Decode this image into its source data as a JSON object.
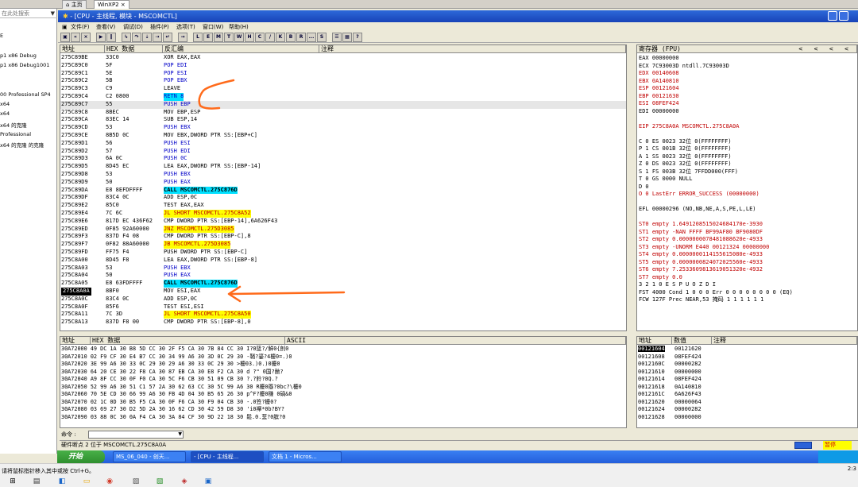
{
  "host": {
    "tabs": [
      "主页",
      "WinXP2"
    ],
    "sidebar_search": "在此处搜索",
    "sidebar_items": [
      "E",
      "p1 x86 Debug",
      "p1 x86 Debug1001",
      "00 Professional SP4",
      "x64",
      "x64 的克隆",
      "Professional",
      "x64 的克隆 的克隆"
    ],
    "status_hint": "请将鼠标指针移入其中或按 Ctrl+G。",
    "clock": "2:3"
  },
  "window": {
    "title": "- [CPU - 主线程, 模块 - MSCOMCTL]",
    "menus": [
      "文件(F)",
      "查看(V)",
      "调试(D)",
      "插件(P)",
      "选项(T)",
      "窗口(W)",
      "帮助(H)"
    ],
    "toolbar_letters": [
      "L",
      "E",
      "M",
      "T",
      "W",
      "H",
      "C",
      "/",
      "K",
      "B",
      "R",
      "...",
      "S"
    ]
  },
  "disasm": {
    "headers": [
      "地址",
      "HEX 数据",
      "反汇编",
      "注释"
    ],
    "rows": [
      {
        "addr": "275C89BE",
        "hex": "33C0",
        "asm": "XOR EAX,EAX",
        "style": ""
      },
      {
        "addr": "275C89C0",
        "hex": "5F",
        "asm": "POP EDI",
        "style": "blu"
      },
      {
        "addr": "275C89C1",
        "hex": "5E",
        "asm": "POP ESI",
        "style": "blu"
      },
      {
        "addr": "275C89C2",
        "hex": "5B",
        "asm": "POP EBX",
        "style": "blu"
      },
      {
        "addr": "275C89C3",
        "hex": "C9",
        "asm": "LEAVE",
        "style": ""
      },
      {
        "addr": "275C89C4",
        "hex": "C2 0800",
        "asm": "RETN 8",
        "style": "retn"
      },
      {
        "addr": "275C89C7",
        "hex": "55",
        "asm": "PUSH EBP",
        "style": "blu hl"
      },
      {
        "addr": "275C89C8",
        "hex": "8BEC",
        "asm": "MOV EBP,ESP",
        "style": ""
      },
      {
        "addr": "275C89CA",
        "hex": "83EC 14",
        "asm": "SUB ESP,14",
        "style": ""
      },
      {
        "addr": "275C89CD",
        "hex": "53",
        "asm": "PUSH EBX",
        "style": "blu"
      },
      {
        "addr": "275C89CE",
        "hex": "8B5D 0C",
        "asm": "MOV EBX,DWORD PTR SS:[EBP+C]",
        "style": "mem"
      },
      {
        "addr": "275C89D1",
        "hex": "56",
        "asm": "PUSH ESI",
        "style": "blu"
      },
      {
        "addr": "275C89D2",
        "hex": "57",
        "asm": "PUSH EDI",
        "style": "blu"
      },
      {
        "addr": "275C89D3",
        "hex": "6A 0C",
        "asm": "PUSH 0C",
        "style": "blu"
      },
      {
        "addr": "275C89D5",
        "hex": "8D45 EC",
        "asm": "LEA EAX,DWORD PTR SS:[EBP-14]",
        "style": "mem"
      },
      {
        "addr": "275C89D8",
        "hex": "53",
        "asm": "PUSH EBX",
        "style": "blu"
      },
      {
        "addr": "275C89D9",
        "hex": "50",
        "asm": "PUSH EAX",
        "style": "blu"
      },
      {
        "addr": "275C89DA",
        "hex": "E8 8EFDFFFF",
        "asm": "CALL MSCOMCTL.275C876D",
        "style": "call"
      },
      {
        "addr": "275C89DF",
        "hex": "83C4 0C",
        "asm": "ADD ESP,0C",
        "style": ""
      },
      {
        "addr": "275C89E2",
        "hex": "85C0",
        "asm": "TEST EAX,EAX",
        "style": ""
      },
      {
        "addr": "275C89E4",
        "hex": "7C 6C",
        "asm": "JL SHORT MSCOMCTL.275C8A52",
        "style": "jmp"
      },
      {
        "addr": "275C89E6",
        "hex": "817D EC 436F62",
        "asm": "CMP DWORD PTR SS:[EBP-14],6A626F43",
        "style": "mem"
      },
      {
        "addr": "275C89ED",
        "hex": "0F85 92A60000",
        "asm": "JNZ MSCOMCTL.275D3085",
        "style": "jmp"
      },
      {
        "addr": "275C89F3",
        "hex": "837D F4 08",
        "asm": "CMP DWORD PTR SS:[EBP-C],8",
        "style": "mem"
      },
      {
        "addr": "275C89F7",
        "hex": "0F82 88A60000",
        "asm": "JB MSCOMCTL.275D3085",
        "style": "jmp"
      },
      {
        "addr": "275C89FD",
        "hex": "FF75 F4",
        "asm": "PUSH DWORD PTR SS:[EBP-C]",
        "style": "mem"
      },
      {
        "addr": "275C8A00",
        "hex": "8D45 F8",
        "asm": "LEA EAX,DWORD PTR SS:[EBP-8]",
        "style": "mem"
      },
      {
        "addr": "275C8A03",
        "hex": "53",
        "asm": "PUSH EBX",
        "style": "blu"
      },
      {
        "addr": "275C8A04",
        "hex": "50",
        "asm": "PUSH EAX",
        "style": "blu"
      },
      {
        "addr": "275C8A05",
        "hex": "E8 63FDFFFF",
        "asm": "CALL MSCOMCTL.275C876D",
        "style": "call"
      },
      {
        "addr": "275C8A0A",
        "hex": "8BF0",
        "asm": "MOV ESI,EAX",
        "style": "sel"
      },
      {
        "addr": "275C8A0C",
        "hex": "83C4 0C",
        "asm": "ADD ESP,0C",
        "style": ""
      },
      {
        "addr": "275C8A0F",
        "hex": "85F6",
        "asm": "TEST ESI,ESI",
        "style": ""
      },
      {
        "addr": "275C8A11",
        "hex": "7C 3D",
        "asm": "JL SHORT MSCOMCTL.275C8A50",
        "style": "jmp"
      },
      {
        "addr": "275C8A13",
        "hex": "837D F8 00",
        "asm": "CMP DWORD PTR SS:[EBP-8],0",
        "style": "mem"
      }
    ]
  },
  "registers": {
    "title": "寄存器 (FPU)",
    "lines": [
      {
        "t": "EAX 00000000",
        "c": ""
      },
      {
        "t": "ECX 7C93003D ntdll.7C93003D",
        "c": ""
      },
      {
        "t": "EDX 00140608",
        "c": "red"
      },
      {
        "t": "EBX 0A140810",
        "c": "red"
      },
      {
        "t": "ESP 00121604",
        "c": "red"
      },
      {
        "t": "EBP 00121630",
        "c": "red"
      },
      {
        "t": "ESI 08FEF424",
        "c": "red"
      },
      {
        "t": "EDI 00000000",
        "c": ""
      },
      {
        "t": "",
        "c": ""
      },
      {
        "t": "EIP 275C8A0A MSCOMCTL.275C8A0A",
        "c": ""
      },
      {
        "t": "",
        "c": ""
      },
      {
        "t": "C 0  ES 0023 32位 0(FFFFFFFF)",
        "c": ""
      },
      {
        "t": "P 1  CS 001B 32位 0(FFFFFFFF)",
        "c": ""
      },
      {
        "t": "A 1  SS 0023 32位 0(FFFFFFFF)",
        "c": ""
      },
      {
        "t": "Z 0  DS 0023 32位 0(FFFFFFFF)",
        "c": ""
      },
      {
        "t": "S 1  FS 003B 32位 7FFDD000(FFF)",
        "c": ""
      },
      {
        "t": "T 0  GS 0000 NULL",
        "c": ""
      },
      {
        "t": "D 0",
        "c": ""
      },
      {
        "t": "O 0  LastErr ERROR_SUCCESS (00000000)",
        "c": ""
      },
      {
        "t": "",
        "c": ""
      },
      {
        "t": "EFL 00000296 (NO,NB,NE,A,S,PE,L,LE)",
        "c": ""
      },
      {
        "t": "",
        "c": ""
      },
      {
        "t": "ST0 empty 1.6491208515024684170e-3930",
        "c": ""
      },
      {
        "t": "ST1 empty -NAN FFFF BF99AF80 BF9080DF",
        "c": ""
      },
      {
        "t": "ST2 empty 0.0000000078481088620e-4933",
        "c": ""
      },
      {
        "t": "ST3 empty -UNORM E440 00121324 00000000",
        "c": ""
      },
      {
        "t": "ST4 empty 0.0000000114155615080e-4933",
        "c": ""
      },
      {
        "t": "ST5 empty 0.0000000824072025560e-4933",
        "c": ""
      },
      {
        "t": "ST6 empty 7.2533609813619051320e-4932",
        "c": ""
      },
      {
        "t": "ST7 empty 0.0",
        "c": ""
      },
      {
        "t": "               3 2 1 0      E S P U O Z D I",
        "c": ""
      },
      {
        "t": "FST 4000  Cond 1 0 0 0  Err 0 0 0 0 0 0 0 0  (EQ)",
        "c": ""
      },
      {
        "t": "FCW 127F  Prec NEAR,53  掩码    1 1 1 1 1 1",
        "c": ""
      }
    ]
  },
  "dump": {
    "headers": [
      "地址",
      "HEX 数据",
      "ASCII"
    ],
    "rows": [
      "30A72000 49 DC 1A 30 B8 5D CC 30 2F F5 CA 30 7B 84 CC 30  I?0篮?/鮮0{剆0",
      "30A72010 02 F9 CF 30 E4 B7 CC 30 34 99 A6 30 3D 0C 29 30  -鞘?鎏?4櫦0=.)0",
      "30A72020 3E 99 A6 30 33 0C 29 30 29 A6 30 33 0C 29 30  >櫦03.)0.)0櫦0",
      "30A72030 64 20 CE 30 22 F8 CA 30 87 EB CA 30 E8 F2 CA 30  d ?\" 0国?酏?",
      "30A72040 A9 8F CC 30 0F F0 CA 30 5C F6 CB 30 51 09 CB 30  ?.?鈴?0Q.?",
      "30A72050 52 99 A6 30 51 C1 57 2A 30 62 63 CC 30 5C 99 A6 30  R櫦0羉?0bc?\\櫦0",
      "30A72060 70 5E CD 30 66 99 A6 30 FB 4D 04 30 B5 65 26 30  p^F?櫦0稴 0碢&0",
      "30A72070 02 1C 0D 30 B5 F5 CA 30 0F F6 CA 30 F9 04 CB 30  -.0笠?櫦0?",
      "30A72080 03 69 27 30 D2 5D 2A 30 16 62 CD 30 42 59 D8 30  'i0襷*0b?BY?",
      "30A72090 03 88 0C 30 0A F4 CA 30 3A 84 CF 30 9D 22 18 30  鬆.0.韮?0膑?0"
    ]
  },
  "stack": {
    "headers": [
      "地址",
      "数值",
      "注释"
    ],
    "rows": [
      [
        "00121604",
        "00121620"
      ],
      [
        "00121608",
        "08FEF424"
      ],
      [
        "0012160C",
        "00000282"
      ],
      [
        "00121610",
        "00000000"
      ],
      [
        "00121614",
        "08FEF424"
      ],
      [
        "00121618",
        "0A140810"
      ],
      [
        "0012161C",
        "6A626F43"
      ],
      [
        "00121620",
        "00000064"
      ],
      [
        "00121624",
        "00000282"
      ],
      [
        "00121628",
        "00000000"
      ]
    ]
  },
  "command": {
    "label": "命令 :"
  },
  "status": {
    "text": "硬件断点 2 位于 MSCOMCTL.275C8A0A",
    "paused": "暂停"
  },
  "taskbar": {
    "start": "开始",
    "tasks": [
      "MS_06_040 - 创天...",
      "- [CPU - 主线程...",
      "文档 1 - Micros..."
    ]
  },
  "colors": {
    "title_blue": "#1843b8",
    "accent_orange": "#ff6a1a",
    "call_cyan": "#00e0ff",
    "jump_yellow": "#ffff00"
  }
}
